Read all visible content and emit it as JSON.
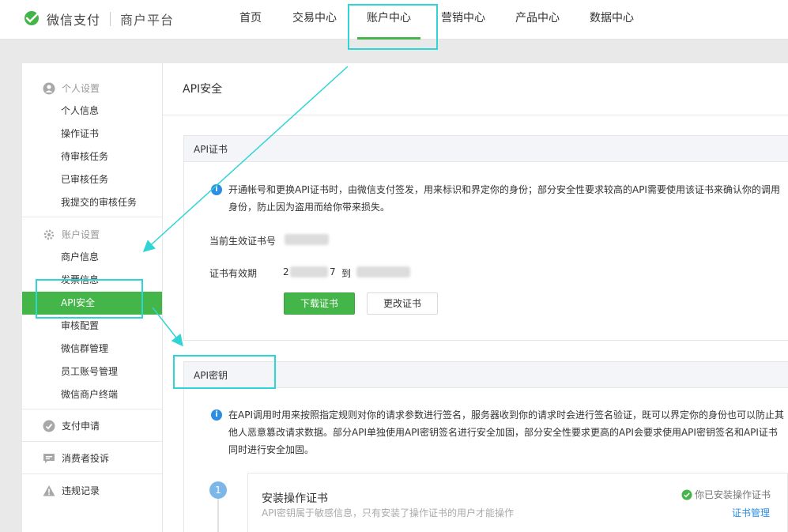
{
  "header": {
    "brand": "微信支付",
    "sub_brand": "商户平台",
    "nav": [
      {
        "label": "首页"
      },
      {
        "label": "交易中心"
      },
      {
        "label": "账户中心"
      },
      {
        "label": "营销中心"
      },
      {
        "label": "产品中心"
      },
      {
        "label": "数据中心"
      }
    ]
  },
  "sidebar": {
    "personal": {
      "title": "个人设置",
      "items": [
        "个人信息",
        "操作证书",
        "待审核任务",
        "已审核任务",
        "我提交的审核任务"
      ]
    },
    "account": {
      "title": "账户设置",
      "items": [
        "商户信息",
        "发票信息",
        "API安全",
        "审核配置",
        "微信群管理",
        "员工账号管理",
        "微信商户终端"
      ]
    },
    "payment_apply": "支付申请",
    "consumer_complaint": "消费者投诉",
    "violation_record": "违规记录"
  },
  "main": {
    "title": "API安全",
    "cert": {
      "header": "API证书",
      "notice_line1": "开通帐号和更换API证书时，由微信支付签发，用来标识和界定你的身份；部分安全性要求较高的API需要使用该证书来确认你的调用",
      "notice_line2": "身份，防止因为盗用而给你带来损失。",
      "serial_label": "当前生效证书号",
      "validity_label": "证书有效期",
      "validity_prefix": "2",
      "validity_mid": "7",
      "validity_to": "到",
      "download_button": "下载证书",
      "change_button": "更改证书"
    },
    "key": {
      "header": "API密钥",
      "notice_line1": "在API调用时用来按照指定规则对你的请求参数进行签名，服务器收到你的请求时会进行签名验证，既可以界定你的身份也可以防止其",
      "notice_line2": "他人恶意篡改请求数据。部分API单独使用API密钥签名进行安全加固，部分安全性要求更高的API会要求使用API密钥签名和API证书",
      "notice_line3": "同时进行安全加固。",
      "step1": {
        "number": "1",
        "title": "安装操作证书",
        "desc": "API密钥属于敏感信息，只有安装了操作证书的用户才能操作",
        "status": "你已安装操作证书",
        "manage_link": "证书管理"
      }
    }
  },
  "colors": {
    "accent": "#44b549",
    "info": "#2b8de4",
    "highlight": "#2fd4d4",
    "link": "#2b8de4"
  }
}
